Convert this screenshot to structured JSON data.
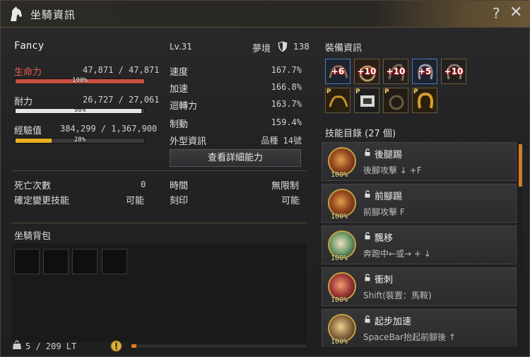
{
  "window": {
    "title": "坐騎資訊",
    "help": "?",
    "close": "✕"
  },
  "mount": {
    "name": "Fancy",
    "level": "Lv.31",
    "realm_label": "夢境",
    "realm_value": "138"
  },
  "stats_left": {
    "hp_label": "生命力",
    "hp_value": "47,871 / 47,871",
    "hp_pct_text": "100%",
    "hp_fraction": 1.0,
    "stamina_label": "耐力",
    "stamina_value": "26,727 / 27,061",
    "stamina_pct_text": "98%",
    "stamina_fraction": 0.98,
    "exp_label": "經驗值",
    "exp_value": "384,299 / 1,367,900",
    "exp_pct_text": "28%",
    "exp_fraction": 0.28
  },
  "stats_right": [
    {
      "label": "速度",
      "value": "167.7%"
    },
    {
      "label": "加速",
      "value": "166.8%"
    },
    {
      "label": "迴轉力",
      "value": "163.7%"
    },
    {
      "label": "制動",
      "value": "159.4%"
    },
    {
      "label": "外型資訊",
      "value": "品種 14號"
    }
  ],
  "detail_button": "查看詳細能力",
  "misc": {
    "deaths_label": "死亡次數",
    "deaths_value": "0",
    "skill_change_label": "確定變更技能",
    "skill_change_value": "可能",
    "time_label": "時間",
    "time_value": "無限制",
    "engrave_label": "刻印",
    "engrave_value": "可能"
  },
  "bag": {
    "title": "坐騎背包",
    "weight": "5 / 209 LT",
    "progress_fraction": 0.03
  },
  "equipment": {
    "title": "裝備資訊",
    "row1": [
      "+6",
      "+10",
      "+10",
      "+5",
      "+10"
    ],
    "row2_badge": "P"
  },
  "skills": {
    "title": "技能目錄 (27 個)",
    "items": [
      {
        "name": "後腿踢",
        "desc": "後腳攻擊 ↓ +F",
        "pct": "100%"
      },
      {
        "name": "前腳踢",
        "desc": "前腳攻擊 F",
        "pct": "100%"
      },
      {
        "name": "飄移",
        "desc": "奔跑中←或→ + ↓",
        "pct": "100%"
      },
      {
        "name": "衝刺",
        "desc": "Shift(裝置：馬鞍)",
        "pct": "100%"
      },
      {
        "name": "起步加速",
        "desc": "SpaceBar抬起前腳後 ↑",
        "pct": "100%"
      }
    ]
  },
  "colors": {
    "hp": "#c8503e",
    "stamina": "#e4e4e4",
    "exp": "#e8b020",
    "accent": "#d07c2a"
  }
}
